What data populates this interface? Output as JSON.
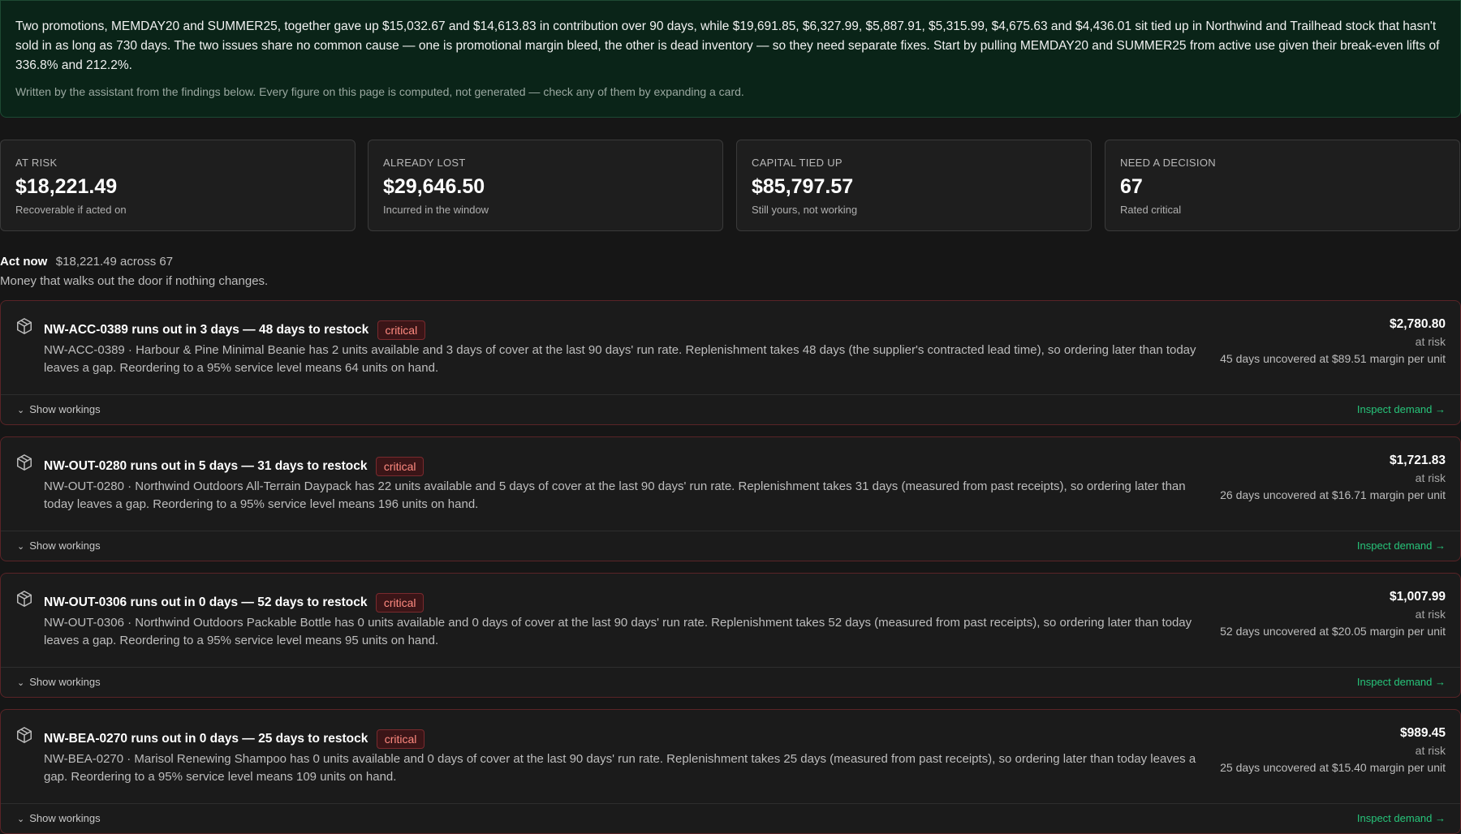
{
  "summary": {
    "text": "Two promotions, MEMDAY20 and SUMMER25, together gave up $15,032.67 and $14,613.83 in contribution over 90 days, while $19,691.85, $6,327.99, $5,887.91, $5,315.99, $4,675.63 and $4,436.01 sit tied up in Northwind and Trailhead stock that hasn't sold in as long as 730 days. The two issues share no common cause — one is promotional margin bleed, the other is dead inventory — so they need separate fixes. Start by pulling MEMDAY20 and SUMMER25 from active use given their break-even lifts of 336.8% and 212.2%.",
    "note": "Written by the assistant from the findings below. Every figure on this page is computed, not generated — check any of them by expanding a card."
  },
  "kpis": [
    {
      "label": "AT RISK",
      "value": "$18,221.49",
      "sub": "Recoverable if acted on"
    },
    {
      "label": "ALREADY LOST",
      "value": "$29,646.50",
      "sub": "Incurred in the window"
    },
    {
      "label": "CAPITAL TIED UP",
      "value": "$85,797.57",
      "sub": "Still yours, not working"
    },
    {
      "label": "NEED A DECISION",
      "value": "67",
      "sub": "Rated critical"
    }
  ],
  "section": {
    "title": "Act now",
    "total": "$18,221.49 across 67",
    "desc": "Money that walks out the door if nothing changes."
  },
  "cards": [
    {
      "title": "NW-ACC-0389 runs out in 3 days — 48 days to restock",
      "badge": "critical",
      "desc": "NW-ACC-0389 · Harbour & Pine Minimal Beanie has 2 units available and 3 days of cover at the last 90 days' run rate. Replenishment takes 48 days (the supplier's contracted lead time), so ordering later than today leaves a gap. Reordering to a 95% service level means 64 units on hand.",
      "amount": "$2,780.80",
      "amount_label": "at risk",
      "gap_note": "45 days uncovered at $89.51 margin per unit",
      "toggle_label": "Show workings",
      "inspect_label": "Inspect demand →"
    },
    {
      "title": "NW-OUT-0280 runs out in 5 days — 31 days to restock",
      "badge": "critical",
      "desc": "NW-OUT-0280 · Northwind Outdoors All-Terrain Daypack has 22 units available and 5 days of cover at the last 90 days' run rate. Replenishment takes 31 days (measured from past receipts), so ordering later than today leaves a gap. Reordering to a 95% service level means 196 units on hand.",
      "amount": "$1,721.83",
      "amount_label": "at risk",
      "gap_note": "26 days uncovered at $16.71 margin per unit",
      "toggle_label": "Show workings",
      "inspect_label": "Inspect demand →"
    },
    {
      "title": "NW-OUT-0306 runs out in 0 days — 52 days to restock",
      "badge": "critical",
      "desc": "NW-OUT-0306 · Northwind Outdoors Packable Bottle has 0 units available and 0 days of cover at the last 90 days' run rate. Replenishment takes 52 days (measured from past receipts), so ordering later than today leaves a gap. Reordering to a 95% service level means 95 units on hand.",
      "amount": "$1,007.99",
      "amount_label": "at risk",
      "gap_note": "52 days uncovered at $20.05 margin per unit",
      "toggle_label": "Show workings",
      "inspect_label": "Inspect demand →"
    },
    {
      "title": "NW-BEA-0270 runs out in 0 days — 25 days to restock",
      "badge": "critical",
      "desc": "NW-BEA-0270 · Marisol Renewing Shampoo has 0 units available and 0 days of cover at the last 90 days' run rate. Replenishment takes 25 days (measured from past receipts), so ordering later than today leaves a gap. Reordering to a 95% service level means 109 units on hand.",
      "amount": "$989.45",
      "amount_label": "at risk",
      "gap_note": "25 days uncovered at $15.40 margin per unit",
      "toggle_label": "Show workings",
      "inspect_label": "Inspect demand →"
    }
  ],
  "colors": {
    "background": "#161616",
    "summary_bg": "#0a2418",
    "critical": "#ff8a80",
    "card_border": "#5a2427",
    "link": "#27c47a"
  },
  "icons": {
    "card": "box-icon",
    "toggle": "chevron-down-icon"
  }
}
